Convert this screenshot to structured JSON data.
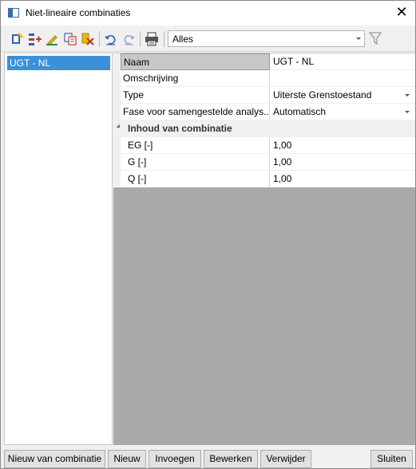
{
  "window": {
    "title": "Niet-lineaire combinaties",
    "close_glyph": "✕"
  },
  "toolbar": {
    "icons": [
      "new-item-icon",
      "insert-icon",
      "edit-icon",
      "copy-icon",
      "delete-icon",
      "undo-icon",
      "redo-icon",
      "print-icon",
      "filter-icon"
    ],
    "filter_value": "Alles"
  },
  "list": {
    "items": [
      {
        "label": "UGT - NL",
        "selected": true
      }
    ]
  },
  "properties": {
    "rows": [
      {
        "label": "Naam",
        "value": "UGT - NL"
      },
      {
        "label": "Omschrijving",
        "value": ""
      },
      {
        "label": "Type",
        "value": "Uiterste Grenstoestand"
      },
      {
        "label": "Fase voor samengestelde analys...",
        "value": "Automatisch"
      }
    ],
    "category": {
      "label": "Inhoud van combinatie",
      "rows": [
        {
          "label": "EG [-]",
          "value": "1,00"
        },
        {
          "label": "G [-]",
          "value": "1,00"
        },
        {
          "label": "Q [-]",
          "value": "1,00"
        }
      ]
    }
  },
  "buttons": {
    "new_combination": "Nieuw van combinatie",
    "new": "Nieuw",
    "insert": "Invoegen",
    "edit": "Bewerken",
    "delete": "Verwijder",
    "close": "Sluiten"
  },
  "colors": {
    "selection": "#3c8fd9",
    "grid_background": "#a9a9a9"
  }
}
